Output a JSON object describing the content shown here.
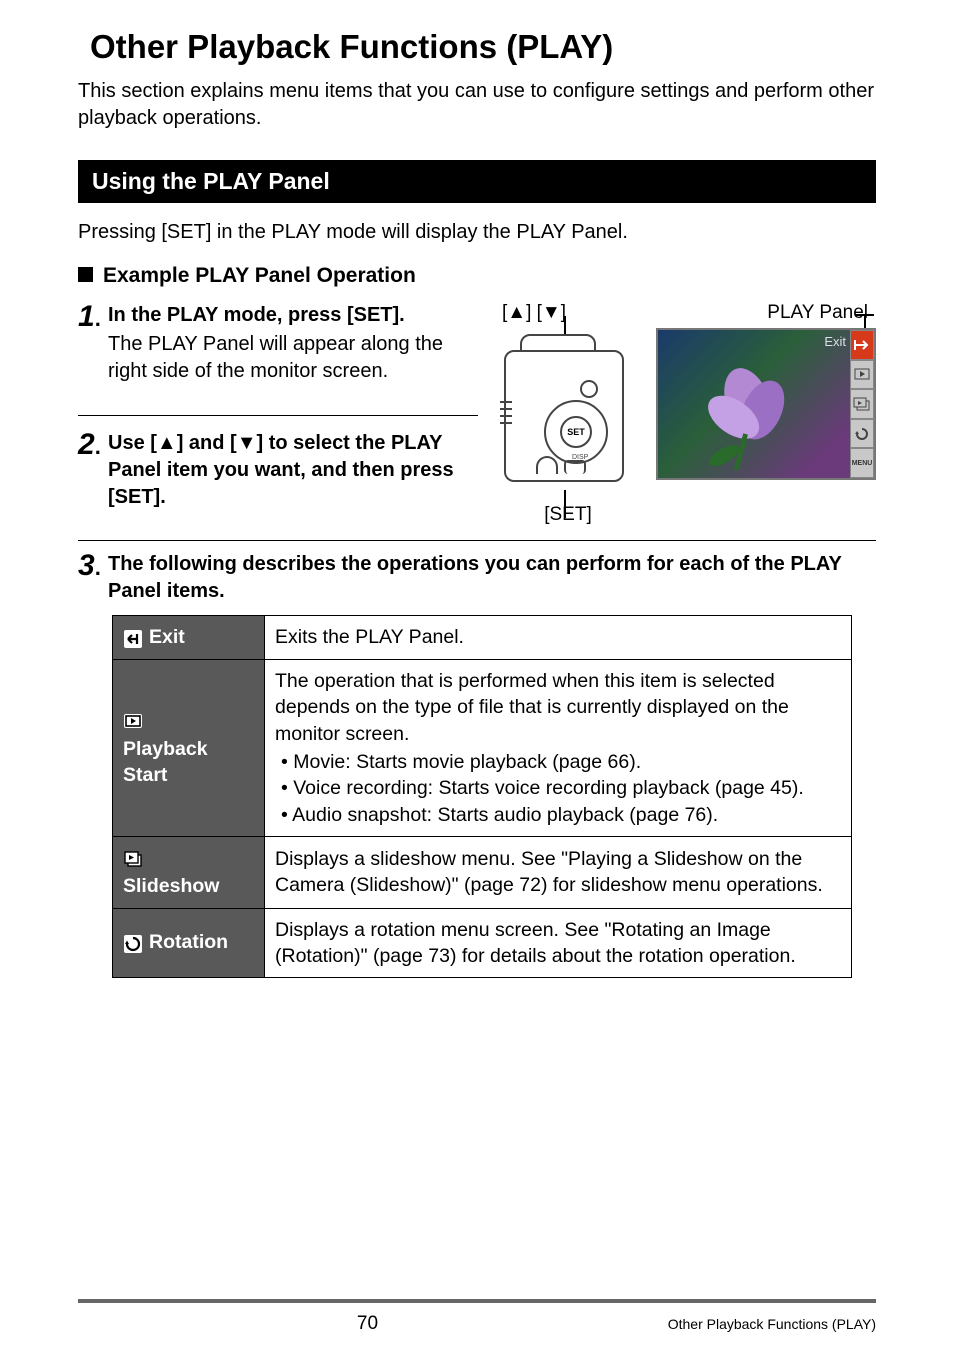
{
  "chapter_title": "Other Playback Functions (PLAY)",
  "intro": "This section explains menu items that you can use to configure settings and perform other playback operations.",
  "section_heading": "Using the PLAY Panel",
  "section_intro": "Pressing [SET] in the PLAY mode will display the PLAY Panel.",
  "example_heading": "Example PLAY Panel Operation",
  "steps": {
    "s1": {
      "num": "1",
      "title": "In the PLAY mode, press [SET].",
      "desc": "The PLAY Panel will appear along the right side of the monitor screen."
    },
    "s2": {
      "num": "2",
      "title": "Use [▲] and [▼] to select the PLAY Panel item you want, and then press [SET]."
    },
    "s3": {
      "num": "3",
      "title": "The following describes the operations you can perform for each of the PLAY Panel items."
    }
  },
  "labels": {
    "arrows": "[▲] [▼]",
    "play_panel": "PLAY Panel",
    "set": "[SET]",
    "screen_exit": "Exit",
    "panel_menu": "MENU",
    "dpad_set": "SET"
  },
  "table": {
    "exit": {
      "label": "Exit",
      "desc": "Exits the PLAY Panel."
    },
    "playback": {
      "label_line1": "Playback",
      "label_line2": "Start",
      "desc_intro": "The operation that is performed when this item is selected depends on the type of file that is currently displayed on the monitor screen.",
      "b1": "Movie: Starts movie playback (page 66).",
      "b2": "Voice recording: Starts voice recording playback (page 45).",
      "b3": "Audio snapshot: Starts audio playback (page 76)."
    },
    "slideshow": {
      "label": "Slideshow",
      "desc": "Displays a slideshow menu. See \"Playing a Slideshow on the Camera (Slideshow)\" (page 72) for slideshow menu operations."
    },
    "rotation": {
      "label": "Rotation",
      "desc": "Displays a rotation menu screen. See \"Rotating an Image (Rotation)\" (page 73) for details about the rotation operation."
    }
  },
  "footer": {
    "page_num": "70",
    "text": "Other Playback Functions (PLAY)"
  }
}
